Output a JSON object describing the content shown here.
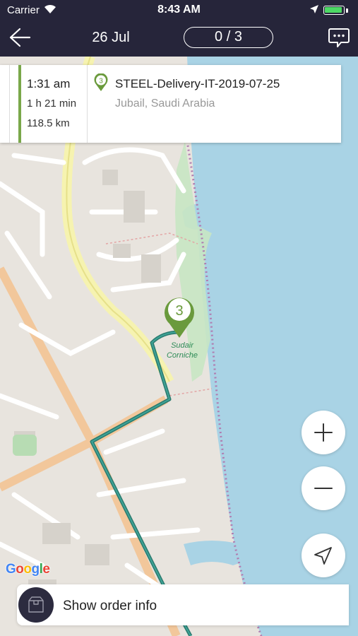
{
  "status_bar": {
    "carrier": "Carrier",
    "time": "8:43 AM",
    "icons": [
      "wifi-icon",
      "location-arrow-icon",
      "battery-icon"
    ]
  },
  "nav": {
    "back_icon": "arrow-left-icon",
    "date": "26 Jul",
    "counter": "0 / 3",
    "chat_icon": "chat-bubble-icon"
  },
  "trip": {
    "eta": "1:31 am",
    "duration": "1 h 21 min",
    "distance": "118.5 km",
    "stop_number": "3",
    "title": "STEEL-Delivery-IT-2019-07-25",
    "location": "Jubail, Saudi Arabia"
  },
  "map": {
    "place_label_1": "Sudair",
    "place_label_2": "Corniche",
    "marker_number": "3",
    "attribution": "Google",
    "route_color": "#2a7a6e",
    "marker_color": "#6a9a3c",
    "water_color": "#a8d4e6"
  },
  "controls": {
    "zoom_in_icon": "plus-icon",
    "zoom_out_icon": "minus-icon",
    "locate_icon": "navigation-arrow-icon"
  },
  "order_bar": {
    "icon": "box-icon",
    "label": "Show order info"
  }
}
